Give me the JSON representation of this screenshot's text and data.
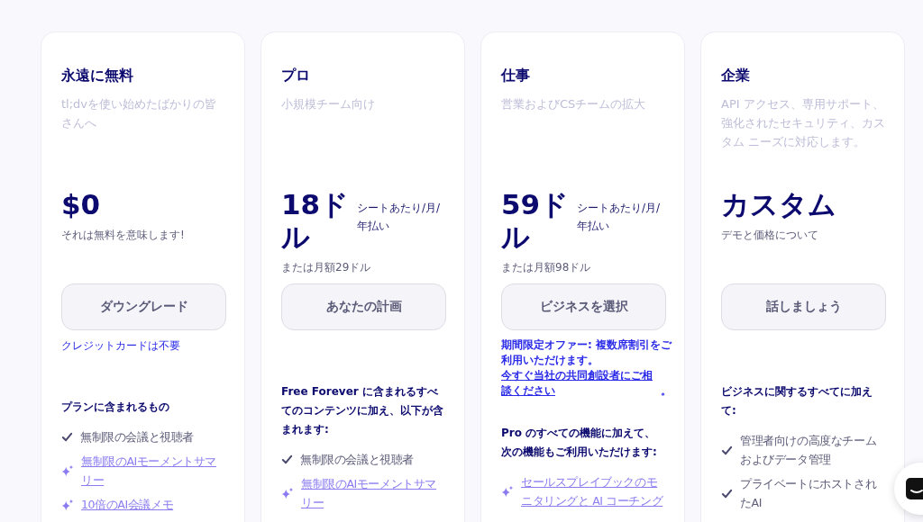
{
  "plans": [
    {
      "title": "永遠に無料",
      "subtitle": "tl;dvを使い始めたばかりの皆さんへ",
      "price": "$0",
      "price_note": "それは無料を意味します!",
      "button": "ダウングレード",
      "note": {
        "bold": false,
        "text": "クレジットカードは不要"
      },
      "features_heading": "プランに含まれるもの",
      "features": [
        {
          "kind": "check",
          "text": "無制限の会議と視聴者"
        },
        {
          "kind": "sparkle",
          "text": "無制限のAIモーメントサマリー"
        },
        {
          "kind": "sparkle",
          "text": "10倍のAI会議メモ"
        }
      ]
    },
    {
      "title": "プロ",
      "subtitle": "小規模チーム向け",
      "price": "18ドル",
      "period": "シートあたり/月/年払い",
      "price_note": "または月額29ドル",
      "button": "あなたの計画",
      "features_heading": "Free Forever に含まれるすべてのコンテンツに加え、以下が含まれます:",
      "features": [
        {
          "kind": "check",
          "text": "無制限の会議と視聴者"
        },
        {
          "kind": "sparkle",
          "text": "無制限のAIモーメントサマリー"
        }
      ]
    },
    {
      "title": "仕事",
      "subtitle": "営業およびCSチームの拡大",
      "price": "59ドル",
      "period": "シートあたり/月/年払い",
      "price_note": "または月額98ドル",
      "button": "ビジネスを選択",
      "note": {
        "bold": true,
        "text": "期間限定オファー: 複数席割引をご利用いただけます。",
        "link": "今すぐ当社の共同創設者にご相談ください",
        "after": "。"
      },
      "features_heading": "Pro のすべての機能に加えて、次の機能もご利用いただけます:",
      "features": [
        {
          "kind": "sparkle",
          "text": "セールスプレイブックのモニタリングと AI コーチング"
        }
      ]
    },
    {
      "title": "企業",
      "subtitle": "API アクセス、専用サポート、強化されたセキュリティ、カスタム ニーズに対応します。",
      "price": "カスタム",
      "price_note": "デモと価格について",
      "button": "話しましょう",
      "features_heading": "ビジネスに関するすべてに加えて:",
      "features": [
        {
          "kind": "check",
          "text": "管理者向けの高度なチームおよびデータ管理"
        },
        {
          "kind": "check",
          "text": "プライベートにホストされたAI"
        }
      ]
    }
  ]
}
